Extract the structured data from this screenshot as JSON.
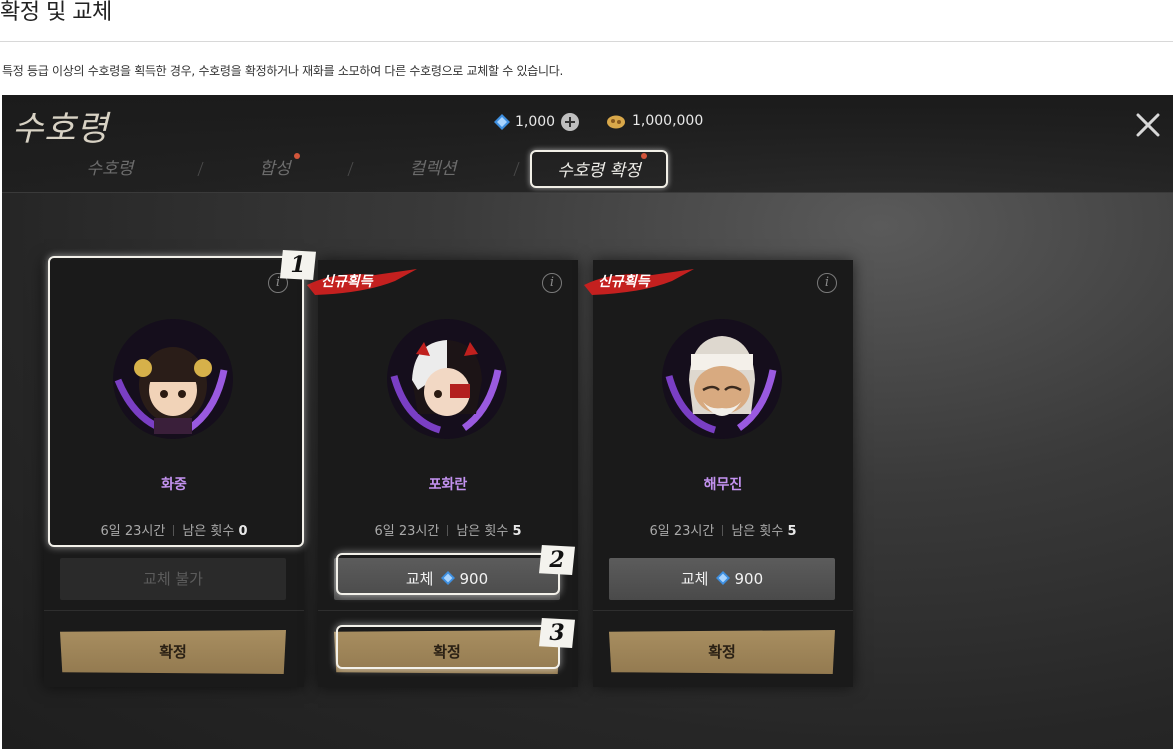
{
  "page": {
    "title": "확정 및 교체",
    "description": "특정 등급 이상의 수호령을 획득한 경우, 수호령을 확정하거나 재화를 소모하여 다른 수호령으로 교체할 수 있습니다."
  },
  "game": {
    "logo": "수호령",
    "currency": {
      "gem": "1,000",
      "gold": "1,000,000"
    },
    "tabs": [
      {
        "label": "수호령",
        "has_dot": false
      },
      {
        "label": "합성",
        "has_dot": true
      },
      {
        "label": "컬렉션",
        "has_dot": false
      },
      {
        "label": "수호령 확정",
        "has_dot": true,
        "active": true
      }
    ],
    "ribbon_label": "신규획득",
    "cards": [
      {
        "name": "화중",
        "timer": "6일 23시간",
        "remaining_label": "남은 횟수",
        "remaining": "0",
        "swap_label": "교체 불가",
        "swap_enabled": false,
        "confirm_label": "확정",
        "new_badge": false
      },
      {
        "name": "포화란",
        "timer": "6일 23시간",
        "remaining_label": "남은 횟수",
        "remaining": "5",
        "swap_label": "교체",
        "swap_cost": "900",
        "swap_enabled": true,
        "confirm_label": "확정",
        "new_badge": true
      },
      {
        "name": "해무진",
        "timer": "6일 23시간",
        "remaining_label": "남은 횟수",
        "remaining": "5",
        "swap_label": "교체",
        "swap_cost": "900",
        "swap_enabled": true,
        "confirm_label": "확정",
        "new_badge": true
      }
    ],
    "steps": [
      "1",
      "2",
      "3"
    ],
    "info_glyph": "i"
  },
  "colors": {
    "name": "#c392f0",
    "confirm": "#a88e60",
    "highlight": "#f3f1ea",
    "dot": "#d2553a"
  },
  "icons": [
    "gem-icon",
    "plus-icon",
    "gold-icon",
    "close-icon",
    "info-icon"
  ]
}
